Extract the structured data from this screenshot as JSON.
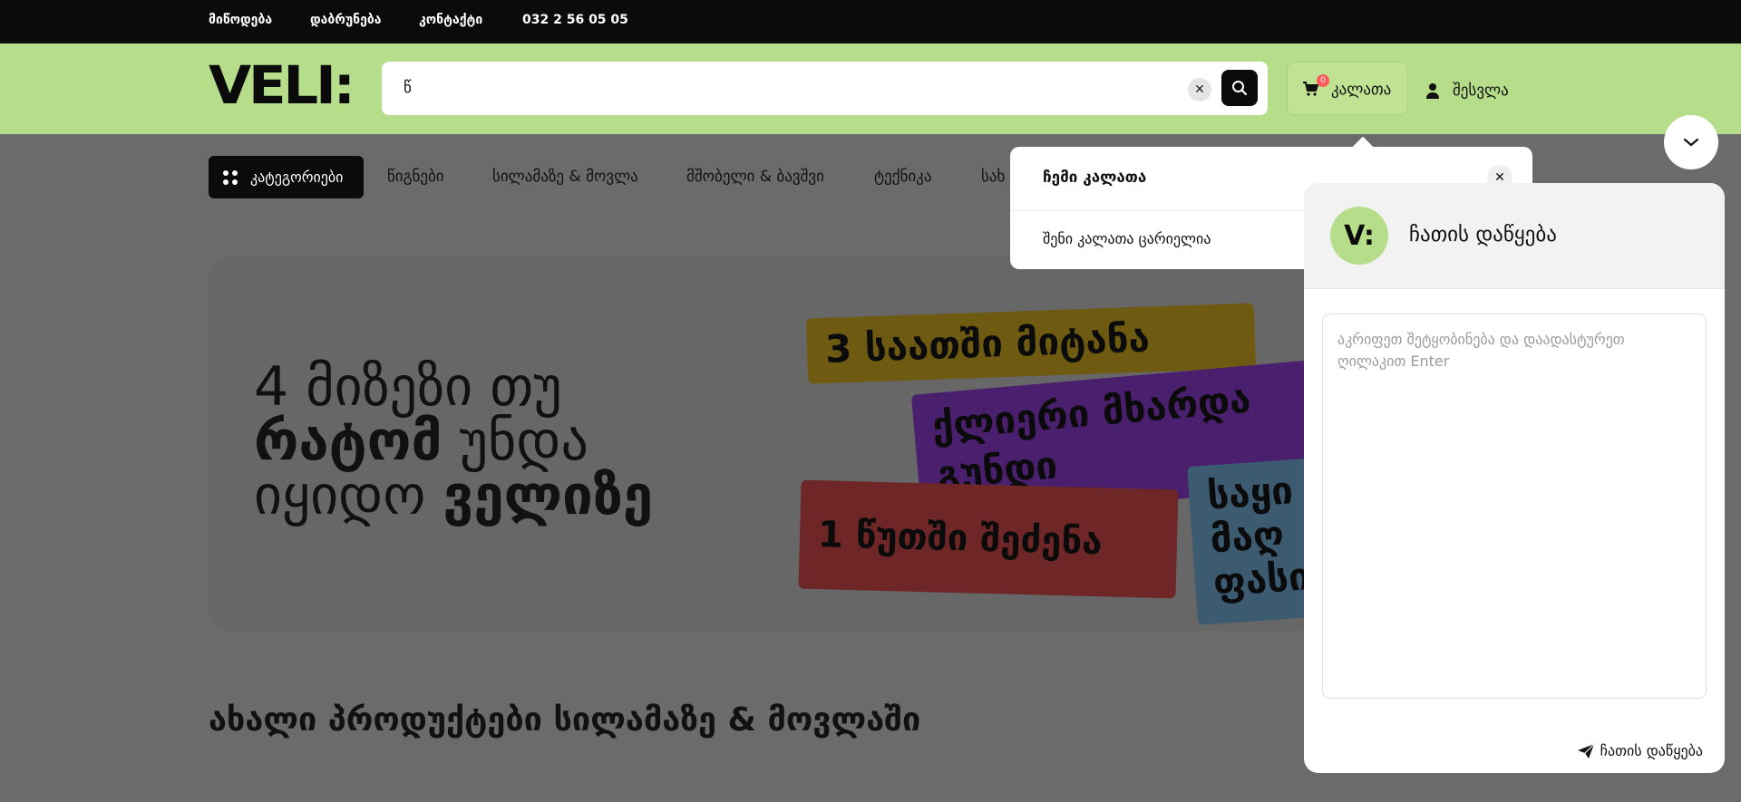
{
  "topbar": {
    "links": [
      "მიწოდება",
      "დაბრუნება",
      "კონტაქტი"
    ],
    "phone": "032 2 56 05 05"
  },
  "header": {
    "logo": "VELI:",
    "search_value": "წ",
    "cart_label": "კალათა",
    "cart_count": "0",
    "login_label": "შესვლა"
  },
  "nav": {
    "categories_label": "კატეგორიები",
    "items": [
      "წიგნები",
      "სილამაზე & მოვლა",
      "მშობელი & ბავშვი",
      "ტექნიკა",
      "სახ"
    ]
  },
  "banner": {
    "line1": "4 მიზეზი თუ",
    "line2_bold": "რატომ",
    "line2_rest": "უნდა",
    "line3": "იყიდო",
    "line3_bold": "ველიზე",
    "tags": [
      "3 საათში მიტანა",
      "ქლიერი მხარდა",
      "გუნდი",
      "1 წუთში შეძენა",
      "საყი",
      "მაღ",
      "ფასი"
    ],
    "tag_colors": [
      "#6e5a10",
      "#4a1f6e",
      "#6e2626",
      "#3c5a70"
    ]
  },
  "section_title": "ახალი პროდუქტები სილამაზე & მოვლაში",
  "cart_dropdown": {
    "title": "ჩემი კალათა",
    "empty_text": "შენი კალათა ცარიელია"
  },
  "chat": {
    "title": "ჩათის დაწყება",
    "avatar_text": "V:",
    "placeholder": "აკრიფეთ შეტყობინება და დაადასტურეთ ღილაკით Enter",
    "send_label": "ჩათის დაწყება"
  },
  "colors": {
    "header_bg": "#b6dd8a",
    "topbar_bg": "#0b0b0b",
    "badge": "#ff5b5b"
  }
}
